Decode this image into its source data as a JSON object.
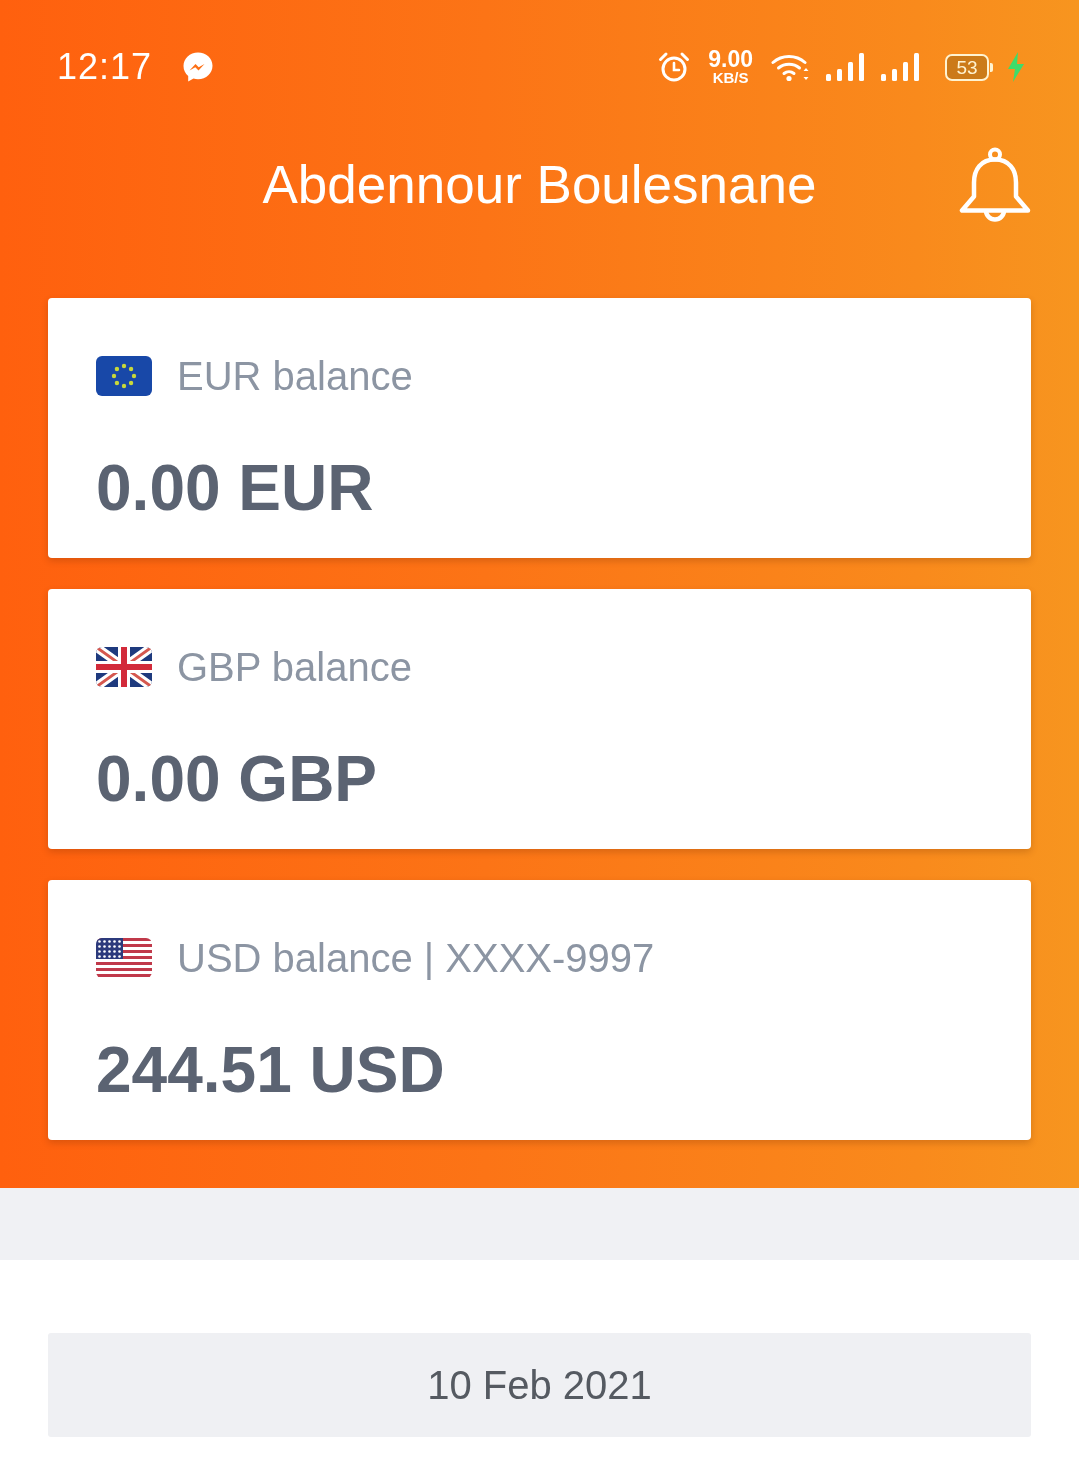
{
  "status_bar": {
    "time": "12:17",
    "network_speed": "9.00",
    "network_speed_unit": "KB/S",
    "battery": "53",
    "charging": true
  },
  "header": {
    "title": "Abdennour Boulesnane"
  },
  "balances": [
    {
      "kind": "eu",
      "label": "EUR balance",
      "amount": "0.00 EUR"
    },
    {
      "kind": "gb",
      "label": "GBP balance",
      "amount": "0.00 GBP"
    },
    {
      "kind": "us",
      "label": "USD balance | XXXX-9997",
      "amount": "244.51 USD"
    }
  ],
  "transactions": {
    "date": "10 Feb 2021"
  }
}
